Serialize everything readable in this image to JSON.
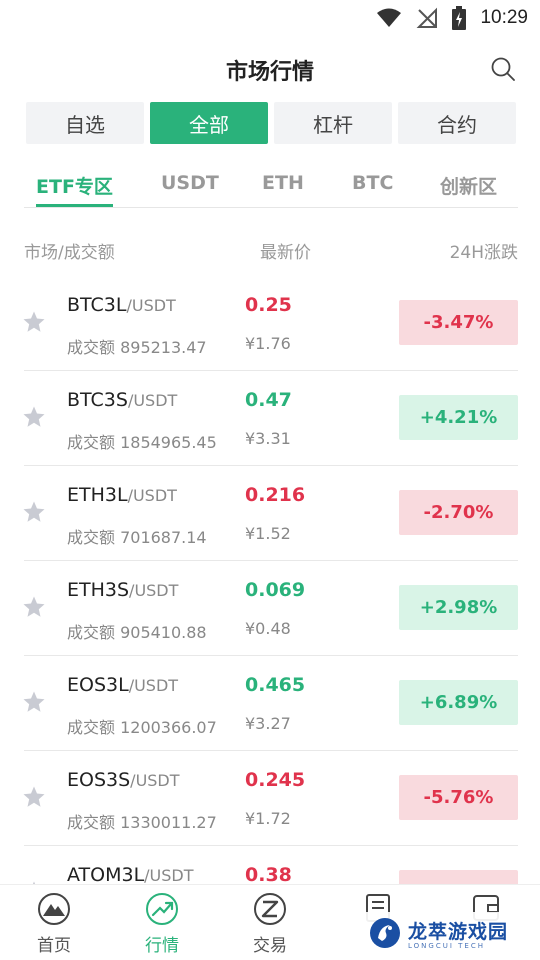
{
  "status_bar": {
    "time": "10:29"
  },
  "header": {
    "title": "市场行情"
  },
  "top_tabs": [
    {
      "label": "自选"
    },
    {
      "label": "全部",
      "active": true
    },
    {
      "label": "杠杆"
    },
    {
      "label": "合约"
    }
  ],
  "sub_tabs": [
    {
      "label": "ETF专区",
      "active": true
    },
    {
      "label": "USDT"
    },
    {
      "label": "ETH"
    },
    {
      "label": "BTC"
    },
    {
      "label": "创新区"
    }
  ],
  "columns": {
    "market": "市场/成交额",
    "price": "最新价",
    "change": "24H涨跌"
  },
  "rows": [
    {
      "base": "BTC3L",
      "quote": "/USDT",
      "volume": "成交额 895213.47",
      "price": "0.25",
      "cny": "¥1.76",
      "change": "-3.47%",
      "direction": "down"
    },
    {
      "base": "BTC3S",
      "quote": "/USDT",
      "volume": "成交额 1854965.45",
      "price": "0.47",
      "cny": "¥3.31",
      "change": "+4.21%",
      "direction": "up"
    },
    {
      "base": "ETH3L",
      "quote": "/USDT",
      "volume": "成交额 701687.14",
      "price": "0.216",
      "cny": "¥1.52",
      "change": "-2.70%",
      "direction": "down"
    },
    {
      "base": "ETH3S",
      "quote": "/USDT",
      "volume": "成交额 905410.88",
      "price": "0.069",
      "cny": "¥0.48",
      "change": "+2.98%",
      "direction": "up"
    },
    {
      "base": "EOS3L",
      "quote": "/USDT",
      "volume": "成交额 1200366.07",
      "price": "0.465",
      "cny": "¥3.27",
      "change": "+6.89%",
      "direction": "up"
    },
    {
      "base": "EOS3S",
      "quote": "/USDT",
      "volume": "成交额 1330011.27",
      "price": "0.245",
      "cny": "¥1.72",
      "change": "-5.76%",
      "direction": "down"
    },
    {
      "base": "ATOM3L",
      "quote": "/USDT",
      "volume": "",
      "price": "0.38",
      "cny": "",
      "change": "",
      "direction": "down"
    }
  ],
  "bottom_nav": [
    {
      "label": "首页",
      "icon": "home-mountain-icon"
    },
    {
      "label": "行情",
      "icon": "market-trend-icon",
      "active": true
    },
    {
      "label": "交易",
      "icon": "trade-icon"
    },
    {
      "label": "",
      "icon": "orders-icon"
    },
    {
      "label": "",
      "icon": "assets-icon"
    }
  ],
  "watermark": {
    "main": "龙萃游戏园",
    "sub": "LONGCUI TECH"
  },
  "colors": {
    "accent": "#2ab27b",
    "up": "#2ab27b",
    "down": "#e0334c",
    "up_bg": "#d9f4e7",
    "down_bg": "#f9dade"
  }
}
